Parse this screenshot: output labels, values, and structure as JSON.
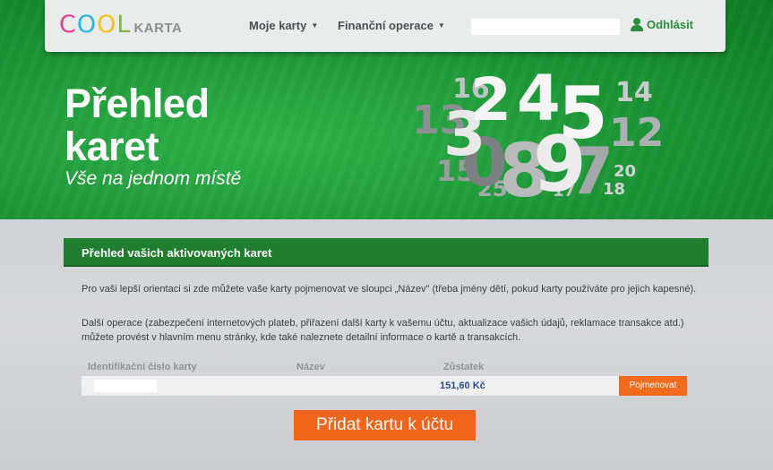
{
  "header": {
    "logo": {
      "cool_letters": [
        "C",
        "O",
        "O",
        "L"
      ],
      "karta": "KARTA"
    },
    "nav": [
      {
        "label": "Moje karty"
      },
      {
        "label": "Finanční operace"
      }
    ],
    "logout_label": "Odhlásit"
  },
  "hero": {
    "title_line1": "Přehled",
    "title_line2": "karet",
    "subtitle": "Vše na jednom místě",
    "numbers": [
      "16",
      "2",
      "4",
      "5",
      "14",
      "13",
      "12",
      "8",
      "9",
      "7",
      "15",
      "25",
      "17",
      "20",
      "18",
      "3",
      "0"
    ]
  },
  "panel": {
    "heading": "Přehled vašich aktivovaných karet",
    "paragraph1": "Pro vaši lepší orientaci si zde můžete vaše karty pojmenovat ve sloupci „Název\" (třeba jmény dětí, pokud karty používáte pro jejich kapesné).",
    "paragraph2": "Další operace (zabezpečení internetových plateb, přiřazení další karty k vašemu účtu, aktualizace vašich údajů, reklamace transakce atd.) můžete provést v hlavním menu stránky, kde také naleznete detailní informace o kartě a transakcích."
  },
  "table": {
    "columns": [
      "Identifikační číslo karty",
      "Název",
      "Zůstatek"
    ],
    "rows": [
      {
        "card_id": "",
        "name": "",
        "balance": "151,60 Kč",
        "action": "Pojmenovat"
      }
    ]
  },
  "add_card_label": "Přidat kartu k účtu",
  "colors": {
    "hero_green": "#1e9a38",
    "panel_green": "#1f7f2f",
    "orange": "#f26a1b",
    "link_green": "#2a8f3c",
    "balance_blue": "#2c4a8c"
  }
}
